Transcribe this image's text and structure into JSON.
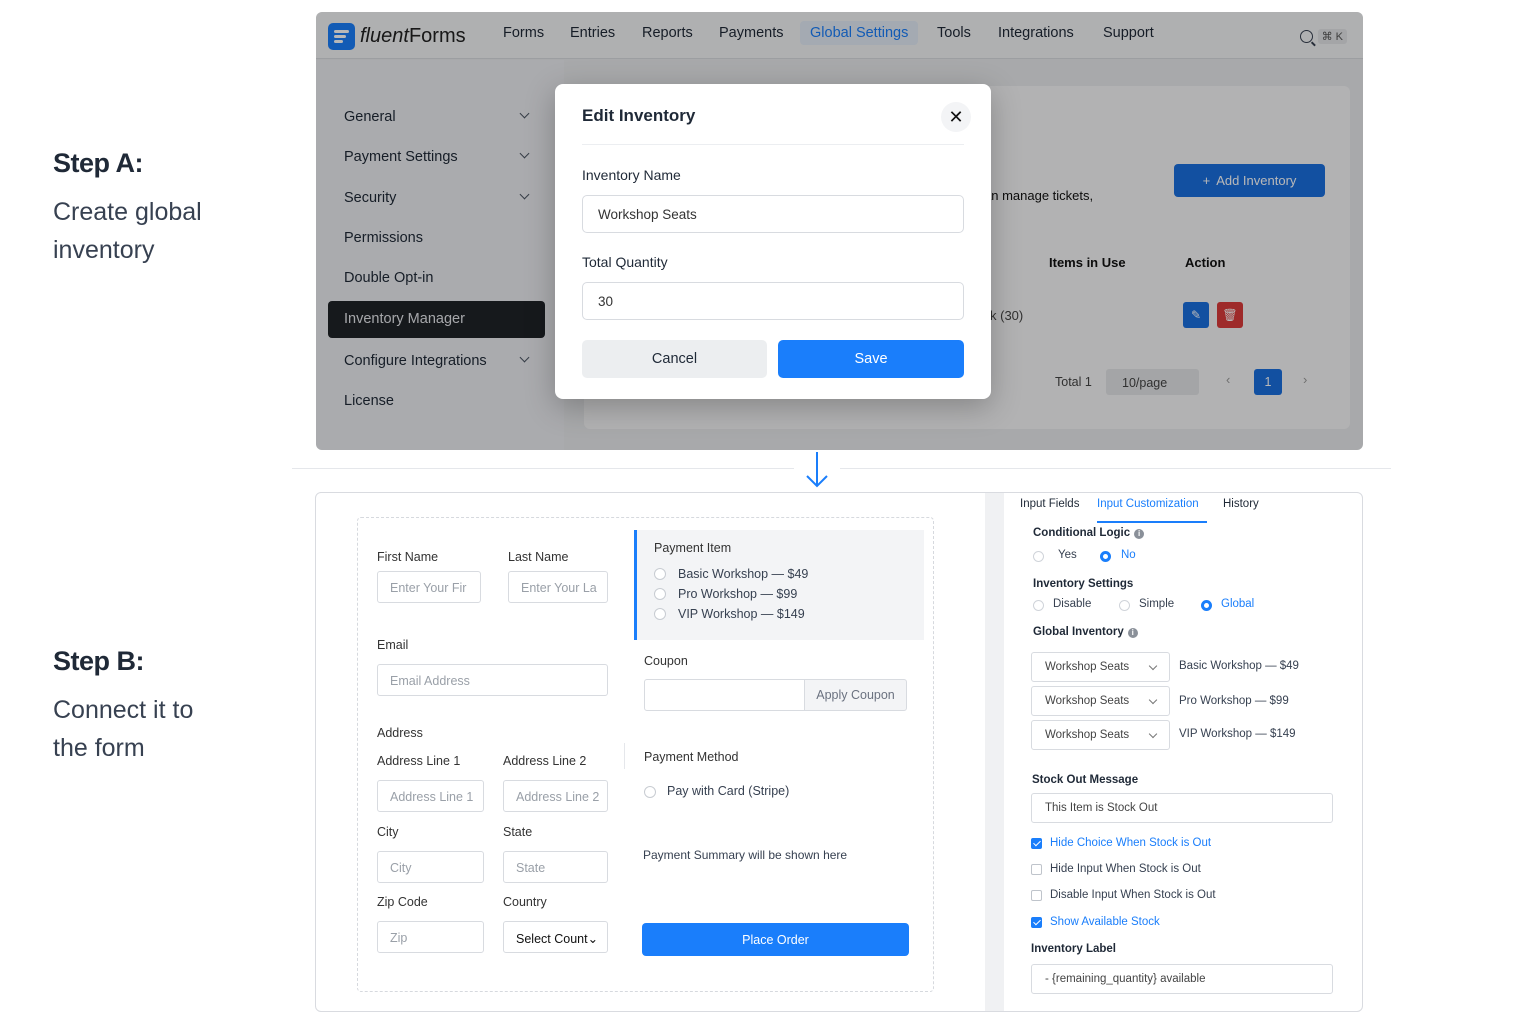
{
  "stepA": {
    "title": "Step A:",
    "line1": "Create global",
    "line2": "inventory"
  },
  "stepB": {
    "title": "Step B:",
    "line1": "Connect it to",
    "line2": "the form"
  },
  "app": {
    "logo_italic": "fluent",
    "logo_rest": "Forms",
    "nav": [
      "Forms",
      "Entries",
      "Reports",
      "Payments",
      "Global Settings",
      "Tools",
      "Integrations",
      "Support"
    ],
    "active_nav": "Global Settings",
    "search_shortcut": "⌘ K"
  },
  "sidebar": {
    "items": [
      "General",
      "Payment Settings",
      "Security",
      "Permissions",
      "Double Opt-in",
      "Inventory Manager",
      "Configure Integrations",
      "License"
    ],
    "active": "Inventory Manager"
  },
  "background_page": {
    "desc_fragment": "an manage tickets,",
    "add_button": "Add Inventory",
    "col_items_in_use": "Items in Use",
    "col_action": "Action",
    "row_fragment": "k (30)",
    "total": "Total 1",
    "per_page": "10/page",
    "current_page": "1"
  },
  "modal": {
    "title": "Edit Inventory",
    "name_label": "Inventory Name",
    "name_value": "Workshop Seats",
    "qty_label": "Total Quantity",
    "qty_value": "30",
    "cancel": "Cancel",
    "save": "Save"
  },
  "form": {
    "first_name_label": "First Name",
    "first_name_ph": "Enter Your Fir",
    "last_name_label": "Last Name",
    "last_name_ph": "Enter Your La",
    "email_label": "Email",
    "email_ph": "Email Address",
    "address_label": "Address",
    "addr1_label": "Address Line 1",
    "addr1_ph": "Address Line 1",
    "addr2_label": "Address Line 2",
    "addr2_ph": "Address Line 2",
    "city_label": "City",
    "city_ph": "City",
    "state_label": "State",
    "state_ph": "State",
    "zip_label": "Zip Code",
    "zip_ph": "Zip",
    "country_label": "Country",
    "country_value": "Select Count",
    "payment_item_label": "Payment Item",
    "payment_items": [
      "Basic Workshop — $49",
      "Pro Workshop — $99",
      "VIP Workshop — $149"
    ],
    "coupon_label": "Coupon",
    "coupon_btn": "Apply Coupon",
    "payment_method_label": "Payment Method",
    "payment_method_option": "Pay with Card (Stripe)",
    "summary": "Payment Summary will be shown here",
    "place_order": "Place Order"
  },
  "settings": {
    "tabs": [
      "Input Fields",
      "Input Customization",
      "History"
    ],
    "active_tab": "Input Customization",
    "conditional_logic": "Conditional Logic",
    "yes": "Yes",
    "no": "No",
    "inventory_settings": "Inventory Settings",
    "inv_opts": [
      "Disable",
      "Simple",
      "Global"
    ],
    "inv_selected": "Global",
    "global_inventory": "Global Inventory",
    "mappings": [
      {
        "inventory": "Workshop Seats",
        "item": "Basic Workshop — $49"
      },
      {
        "inventory": "Workshop Seats",
        "item": "Pro Workshop — $99"
      },
      {
        "inventory": "Workshop Seats",
        "item": "VIP Workshop — $149"
      }
    ],
    "stock_out_label": "Stock Out Message",
    "stock_out_value": "This Item is Stock Out",
    "checkboxes": [
      {
        "label": "Hide Choice When Stock is Out",
        "checked": true
      },
      {
        "label": "Hide Input When Stock is Out",
        "checked": false
      },
      {
        "label": "Disable Input When Stock is Out",
        "checked": false
      },
      {
        "label": "Show Available Stock",
        "checked": true
      }
    ],
    "inventory_label": "Inventory Label",
    "inventory_label_value": "- {remaining_quantity} available"
  },
  "colors": {
    "accent": "#1a7efb",
    "danger": "#dc3b3b",
    "dark": "#1f2328"
  }
}
